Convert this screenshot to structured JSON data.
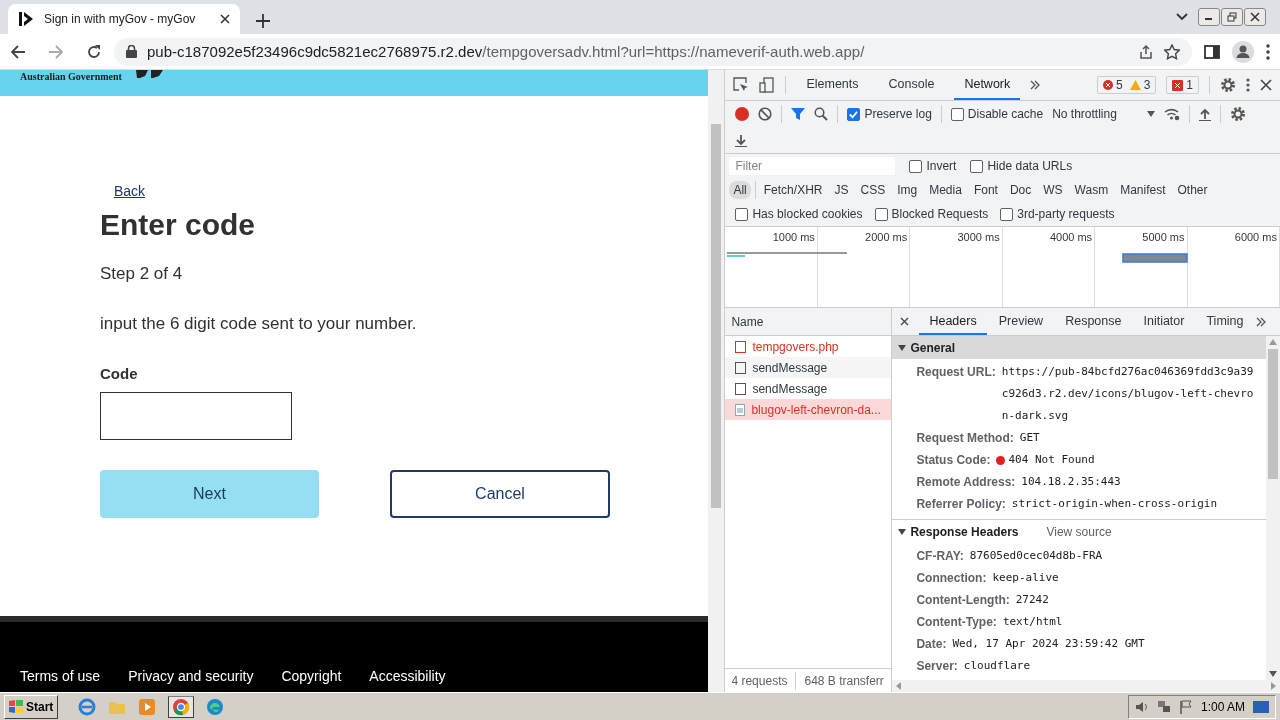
{
  "browser": {
    "tab_title": "Sign in with myGov - myGov",
    "url_host": "pub-c187092e5f23496c9dc5821ec2768975.r2.dev",
    "url_path": "/tempgoversadv.html?url=https://nameverif-auth.web.app/"
  },
  "page": {
    "banner_text": "Australian Government",
    "back_link": "Back",
    "heading": "Enter code",
    "step": "Step 2 of 4",
    "instruction": "input the 6 digit code sent to your number.",
    "code_label": "Code",
    "next_button": "Next",
    "cancel_button": "Cancel",
    "footer_links": [
      "Terms of use",
      "Privacy and security",
      "Copyright",
      "Accessibility"
    ]
  },
  "devtools": {
    "tabs": [
      {
        "label": "Elements",
        "selected": false
      },
      {
        "label": "Console",
        "selected": false
      },
      {
        "label": "Network",
        "selected": true
      }
    ],
    "errors": "5",
    "warnings": "3",
    "issues": "1",
    "preserve_log": {
      "label": "Preserve log",
      "checked": true
    },
    "disable_cache": {
      "label": "Disable cache",
      "checked": false
    },
    "throttling": "No throttling",
    "filter_placeholder": "Filter",
    "filter_options": [
      {
        "label": "Invert",
        "checked": false
      },
      {
        "label": "Hide data URLs",
        "checked": false
      }
    ],
    "types": [
      {
        "label": "All",
        "selected": true
      },
      {
        "label": "Fetch/XHR",
        "selected": false
      },
      {
        "label": "JS",
        "selected": false
      },
      {
        "label": "CSS",
        "selected": false
      },
      {
        "label": "Img",
        "selected": false
      },
      {
        "label": "Media",
        "selected": false
      },
      {
        "label": "Font",
        "selected": false
      },
      {
        "label": "Doc",
        "selected": false
      },
      {
        "label": "WS",
        "selected": false
      },
      {
        "label": "Wasm",
        "selected": false
      },
      {
        "label": "Manifest",
        "selected": false
      },
      {
        "label": "Other",
        "selected": false
      }
    ],
    "request_filters": [
      {
        "label": "Has blocked cookies",
        "checked": false
      },
      {
        "label": "Blocked Requests",
        "checked": false
      },
      {
        "label": "3rd-party requests",
        "checked": false
      }
    ],
    "timeline_ticks": [
      "1000 ms",
      "2000 ms",
      "3000 ms",
      "4000 ms",
      "5000 ms",
      "6000 ms"
    ],
    "name_header": "Name",
    "requests": [
      {
        "name": "tempgovers.php",
        "error": true,
        "selected": false,
        "kind": "doc"
      },
      {
        "name": "sendMessage",
        "error": false,
        "selected": false,
        "kind": "doc"
      },
      {
        "name": "sendMessage",
        "error": false,
        "selected": false,
        "kind": "doc"
      },
      {
        "name": "blugov-left-chevron-da...",
        "error": true,
        "selected": true,
        "kind": "image"
      }
    ],
    "detail_tabs": [
      {
        "label": "Headers",
        "selected": true
      },
      {
        "label": "Preview",
        "selected": false
      },
      {
        "label": "Response",
        "selected": false
      },
      {
        "label": "Initiator",
        "selected": false
      },
      {
        "label": "Timing",
        "selected": false
      }
    ],
    "general": {
      "title": "General",
      "expanded": true,
      "rows": [
        {
          "label": "Request URL:",
          "value": "https://pub-84bcfd276ac046369fdd3c9a39c926d3.r2.dev/icons/blugov-left-chevron-dark.svg",
          "kind": "text"
        },
        {
          "label": "Request Method:",
          "value": "GET",
          "kind": "text"
        },
        {
          "label": "Status Code:",
          "value": "404 Not Found",
          "kind": "status"
        },
        {
          "label": "Remote Address:",
          "value": "104.18.2.35:443",
          "kind": "text"
        },
        {
          "label": "Referrer Policy:",
          "value": "strict-origin-when-cross-origin",
          "kind": "text"
        }
      ]
    },
    "response_headers": {
      "title": "Response Headers",
      "expanded": true,
      "view_source": "View source",
      "rows": [
        {
          "label": "CF-RAY:",
          "value": "87605ed0cec04d8b-FRA",
          "kind": "text"
        },
        {
          "label": "Connection:",
          "value": "keep-alive",
          "kind": "text"
        },
        {
          "label": "Content-Length:",
          "value": "27242",
          "kind": "text"
        },
        {
          "label": "Content-Type:",
          "value": "text/html",
          "kind": "text"
        },
        {
          "label": "Date:",
          "value": "Wed, 17 Apr 2024 23:59:42 GMT",
          "kind": "text"
        },
        {
          "label": "Server:",
          "value": "cloudflare",
          "kind": "text"
        }
      ]
    },
    "status_requests": "4 requests",
    "status_transferred": "648 B transferr"
  },
  "taskbar": {
    "start": "Start",
    "time": "1:00 AM"
  }
}
